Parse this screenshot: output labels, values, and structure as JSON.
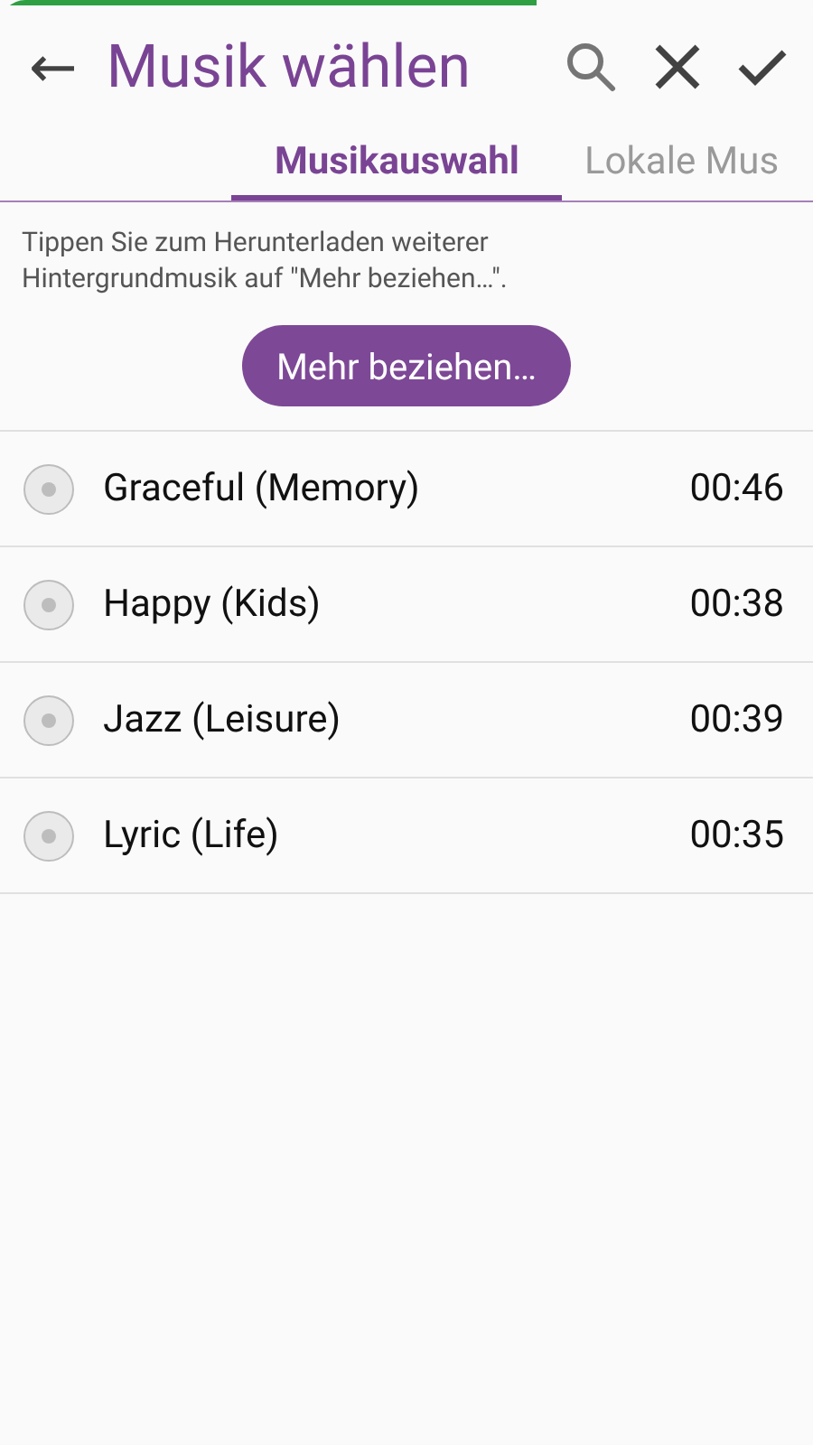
{
  "toolbar": {
    "back": "←",
    "title": "Musik wählen"
  },
  "tabs": [
    {
      "label": "Musikauswahl",
      "selected": true
    },
    {
      "label": "Lokale Mus",
      "selected": false
    }
  ],
  "hint": "Tippen Sie zum Herunterladen weiterer Hintergrundmusik auf \"Mehr beziehen…\".",
  "more_button": "Mehr beziehen…",
  "tracks": [
    {
      "name": "Graceful (Memory)",
      "duration": "00:46",
      "selected": false
    },
    {
      "name": "Happy (Kids)",
      "duration": "00:38",
      "selected": false
    },
    {
      "name": "Jazz (Leisure)",
      "duration": "00:39",
      "selected": false
    },
    {
      "name": "Lyric (Life)",
      "duration": "00:35",
      "selected": false
    }
  ]
}
